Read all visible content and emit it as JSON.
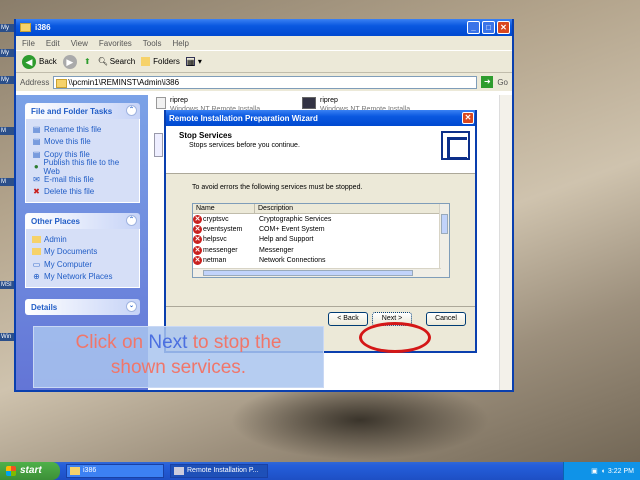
{
  "desktop": {
    "icon_labels": [
      "My",
      "My",
      "My",
      "M",
      "M",
      "MSI",
      "Win"
    ]
  },
  "explorer": {
    "title": "i386",
    "menu": [
      "File",
      "Edit",
      "View",
      "Favorites",
      "Tools",
      "Help"
    ],
    "toolbar": {
      "back": "Back",
      "search": "Search",
      "folders": "Folders"
    },
    "address": {
      "label": "Address",
      "value": "\\\\pcmin1\\REMINST\\Admin\\i386",
      "go": "Go"
    },
    "tasks": {
      "title": "File and Folder Tasks",
      "items": [
        "Rename this file",
        "Move this file",
        "Copy this file",
        "Publish this file to the Web",
        "E-mail this file",
        "Delete this file"
      ]
    },
    "places": {
      "title": "Other Places",
      "items": [
        "Admin",
        "My Documents",
        "My Computer",
        "My Network Places"
      ]
    },
    "details": {
      "title": "Details"
    },
    "files": [
      {
        "name": "riprep",
        "desc": "Windows NT Remote Installa..."
      },
      {
        "name": "riprep",
        "desc": "Windows NT Remote Installa..."
      }
    ]
  },
  "wizard": {
    "title": "Remote Installation Preparation Wizard",
    "heading": "Stop Services",
    "subheading": "Stops services before you continue.",
    "info": "To avoid errors the following services must be stopped.",
    "columns": [
      "Name",
      "Description"
    ],
    "services": [
      {
        "name": "cryptsvc",
        "description": "Cryptographic Services"
      },
      {
        "name": "eventsystem",
        "description": "COM+ Event System"
      },
      {
        "name": "helpsvc",
        "description": "Help and Support"
      },
      {
        "name": "messenger",
        "description": "Messenger"
      },
      {
        "name": "netman",
        "description": "Network Connections"
      }
    ],
    "buttons": {
      "back": "< Back",
      "next": "Next >",
      "cancel": "Cancel"
    }
  },
  "callout": {
    "before": "Click on ",
    "keyword": "Next",
    "after": " to stop the",
    "line2": "shown services."
  },
  "taskbar": {
    "start": "start",
    "tasks": [
      "i386",
      "Remote Installation P..."
    ],
    "clock": "3:22 PM"
  },
  "colors": {
    "title_blue": "#0a58e0",
    "callout_text": "#f0766a",
    "callout_keyword": "#4b6fe0",
    "highlight_ring": "#d41717"
  }
}
